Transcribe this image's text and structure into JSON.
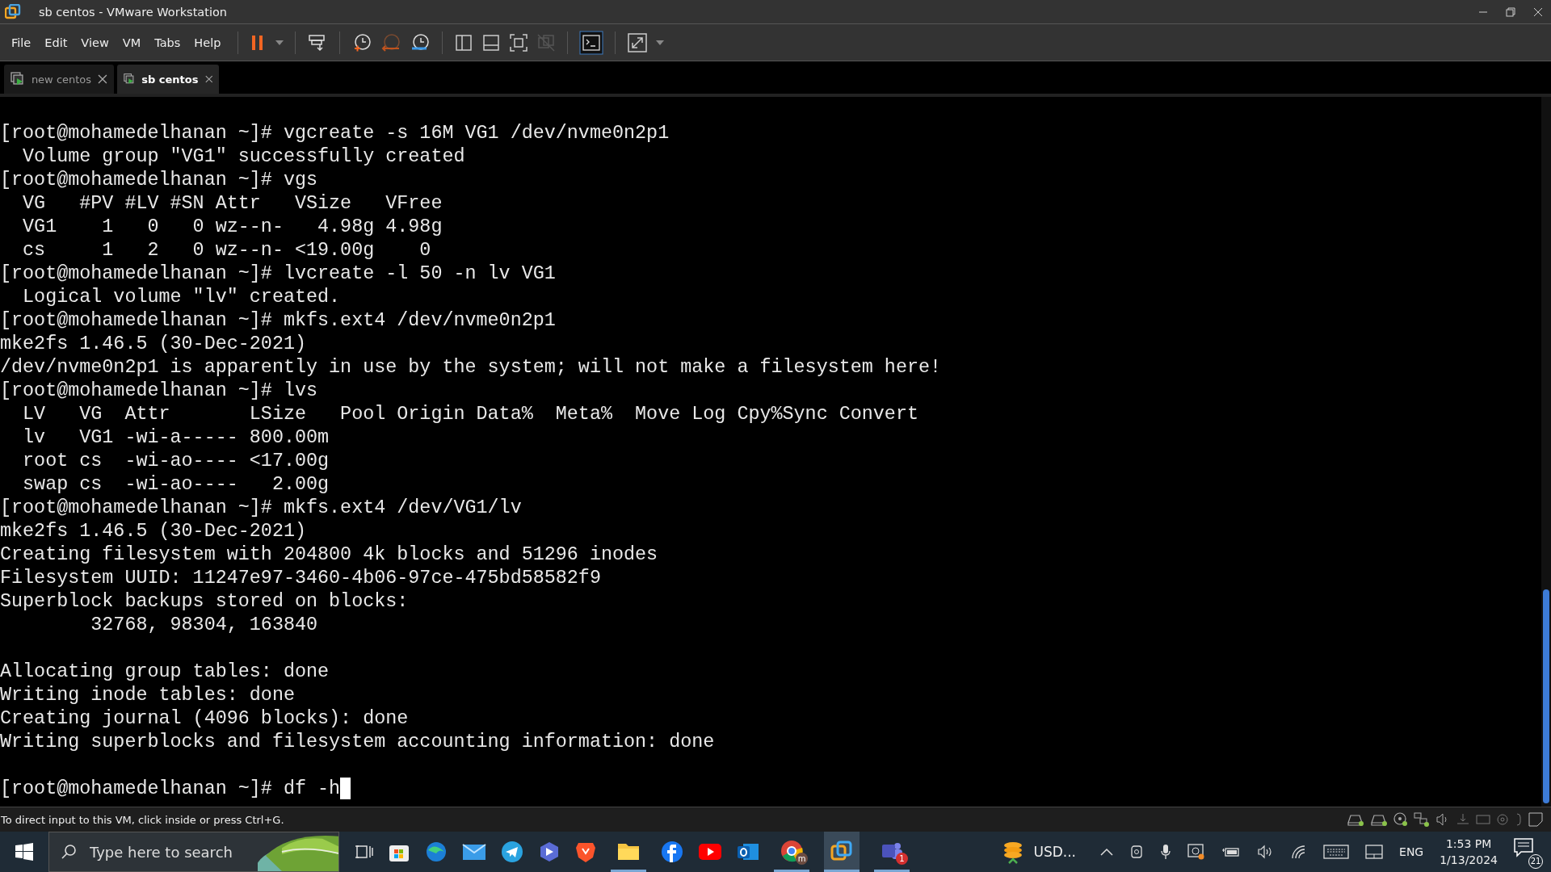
{
  "window": {
    "title": "sb centos - VMware Workstation"
  },
  "menu": [
    {
      "label": "File"
    },
    {
      "label": "Edit"
    },
    {
      "label": "View"
    },
    {
      "label": "VM"
    },
    {
      "label": "Tabs"
    },
    {
      "label": "Help"
    }
  ],
  "tabs": [
    {
      "label": "new centos",
      "selected": false
    },
    {
      "label": "sb centos",
      "selected": true
    }
  ],
  "terminal": {
    "blocks": [
      {
        "lines": [
          "[root@mohamedelhanan ~]# vgcreate -s 16M VG1 /dev/nvme0n2p1",
          "  Volume group \"VG1\" successfully created",
          "[root@mohamedelhanan ~]# vgs",
          "  VG   #PV #LV #SN Attr   VSize   VFree",
          "  VG1    1   0   0 wz--n-   4.98g 4.98g",
          "  cs     1   2   0 wz--n- <19.00g    0",
          "[root@mohamedelhanan ~]# lvcreate -l 50 -n lv VG1",
          "  Logical volume \"lv\" created.",
          "[root@mohamedelhanan ~]# mkfs.ext4 /dev/nvme0n2p1",
          "mke2fs 1.46.5 (30-Dec-2021)",
          "/dev/nvme0n2p1 is apparently in use by the system; will not make a filesystem here!",
          "[root@mohamedelhanan ~]# lvs",
          "  LV   VG  Attr       LSize   Pool Origin Data%  Meta%  Move Log Cpy%Sync Convert",
          "  lv   VG1 -wi-a----- 800.00m",
          "  root cs  -wi-ao---- <17.00g",
          "  swap cs  -wi-ao----   2.00g",
          "[root@mohamedelhanan ~]# mkfs.ext4 /dev/VG1/lv",
          "mke2fs 1.46.5 (30-Dec-2021)",
          "Creating filesystem with 204800 4k blocks and 51296 inodes",
          "Filesystem UUID: 11247e97-3460-4b06-97ce-475bd58582f9",
          "Superblock backups stored on blocks:",
          "        32768, 98304, 163840"
        ]
      },
      {
        "lines": [
          "Allocating group tables: done",
          "Writing inode tables: done",
          "Creating journal (4096 blocks): done",
          "Writing superblocks and filesystem accounting information: done"
        ]
      },
      {
        "lines": [
          "[root@mohamedelhanan ~]# df -h"
        ]
      }
    ],
    "cursor": true
  },
  "status_bar": {
    "text": "To direct input to this VM, click inside or press Ctrl+G."
  },
  "taskbar": {
    "search": {
      "placeholder": "Type here to search"
    },
    "chrome_badge": "m",
    "teams_badge": "1",
    "weather": "USD...",
    "language": "ENG",
    "time": "1:53 PM",
    "date": "1/13/2024",
    "notifications": "21"
  }
}
